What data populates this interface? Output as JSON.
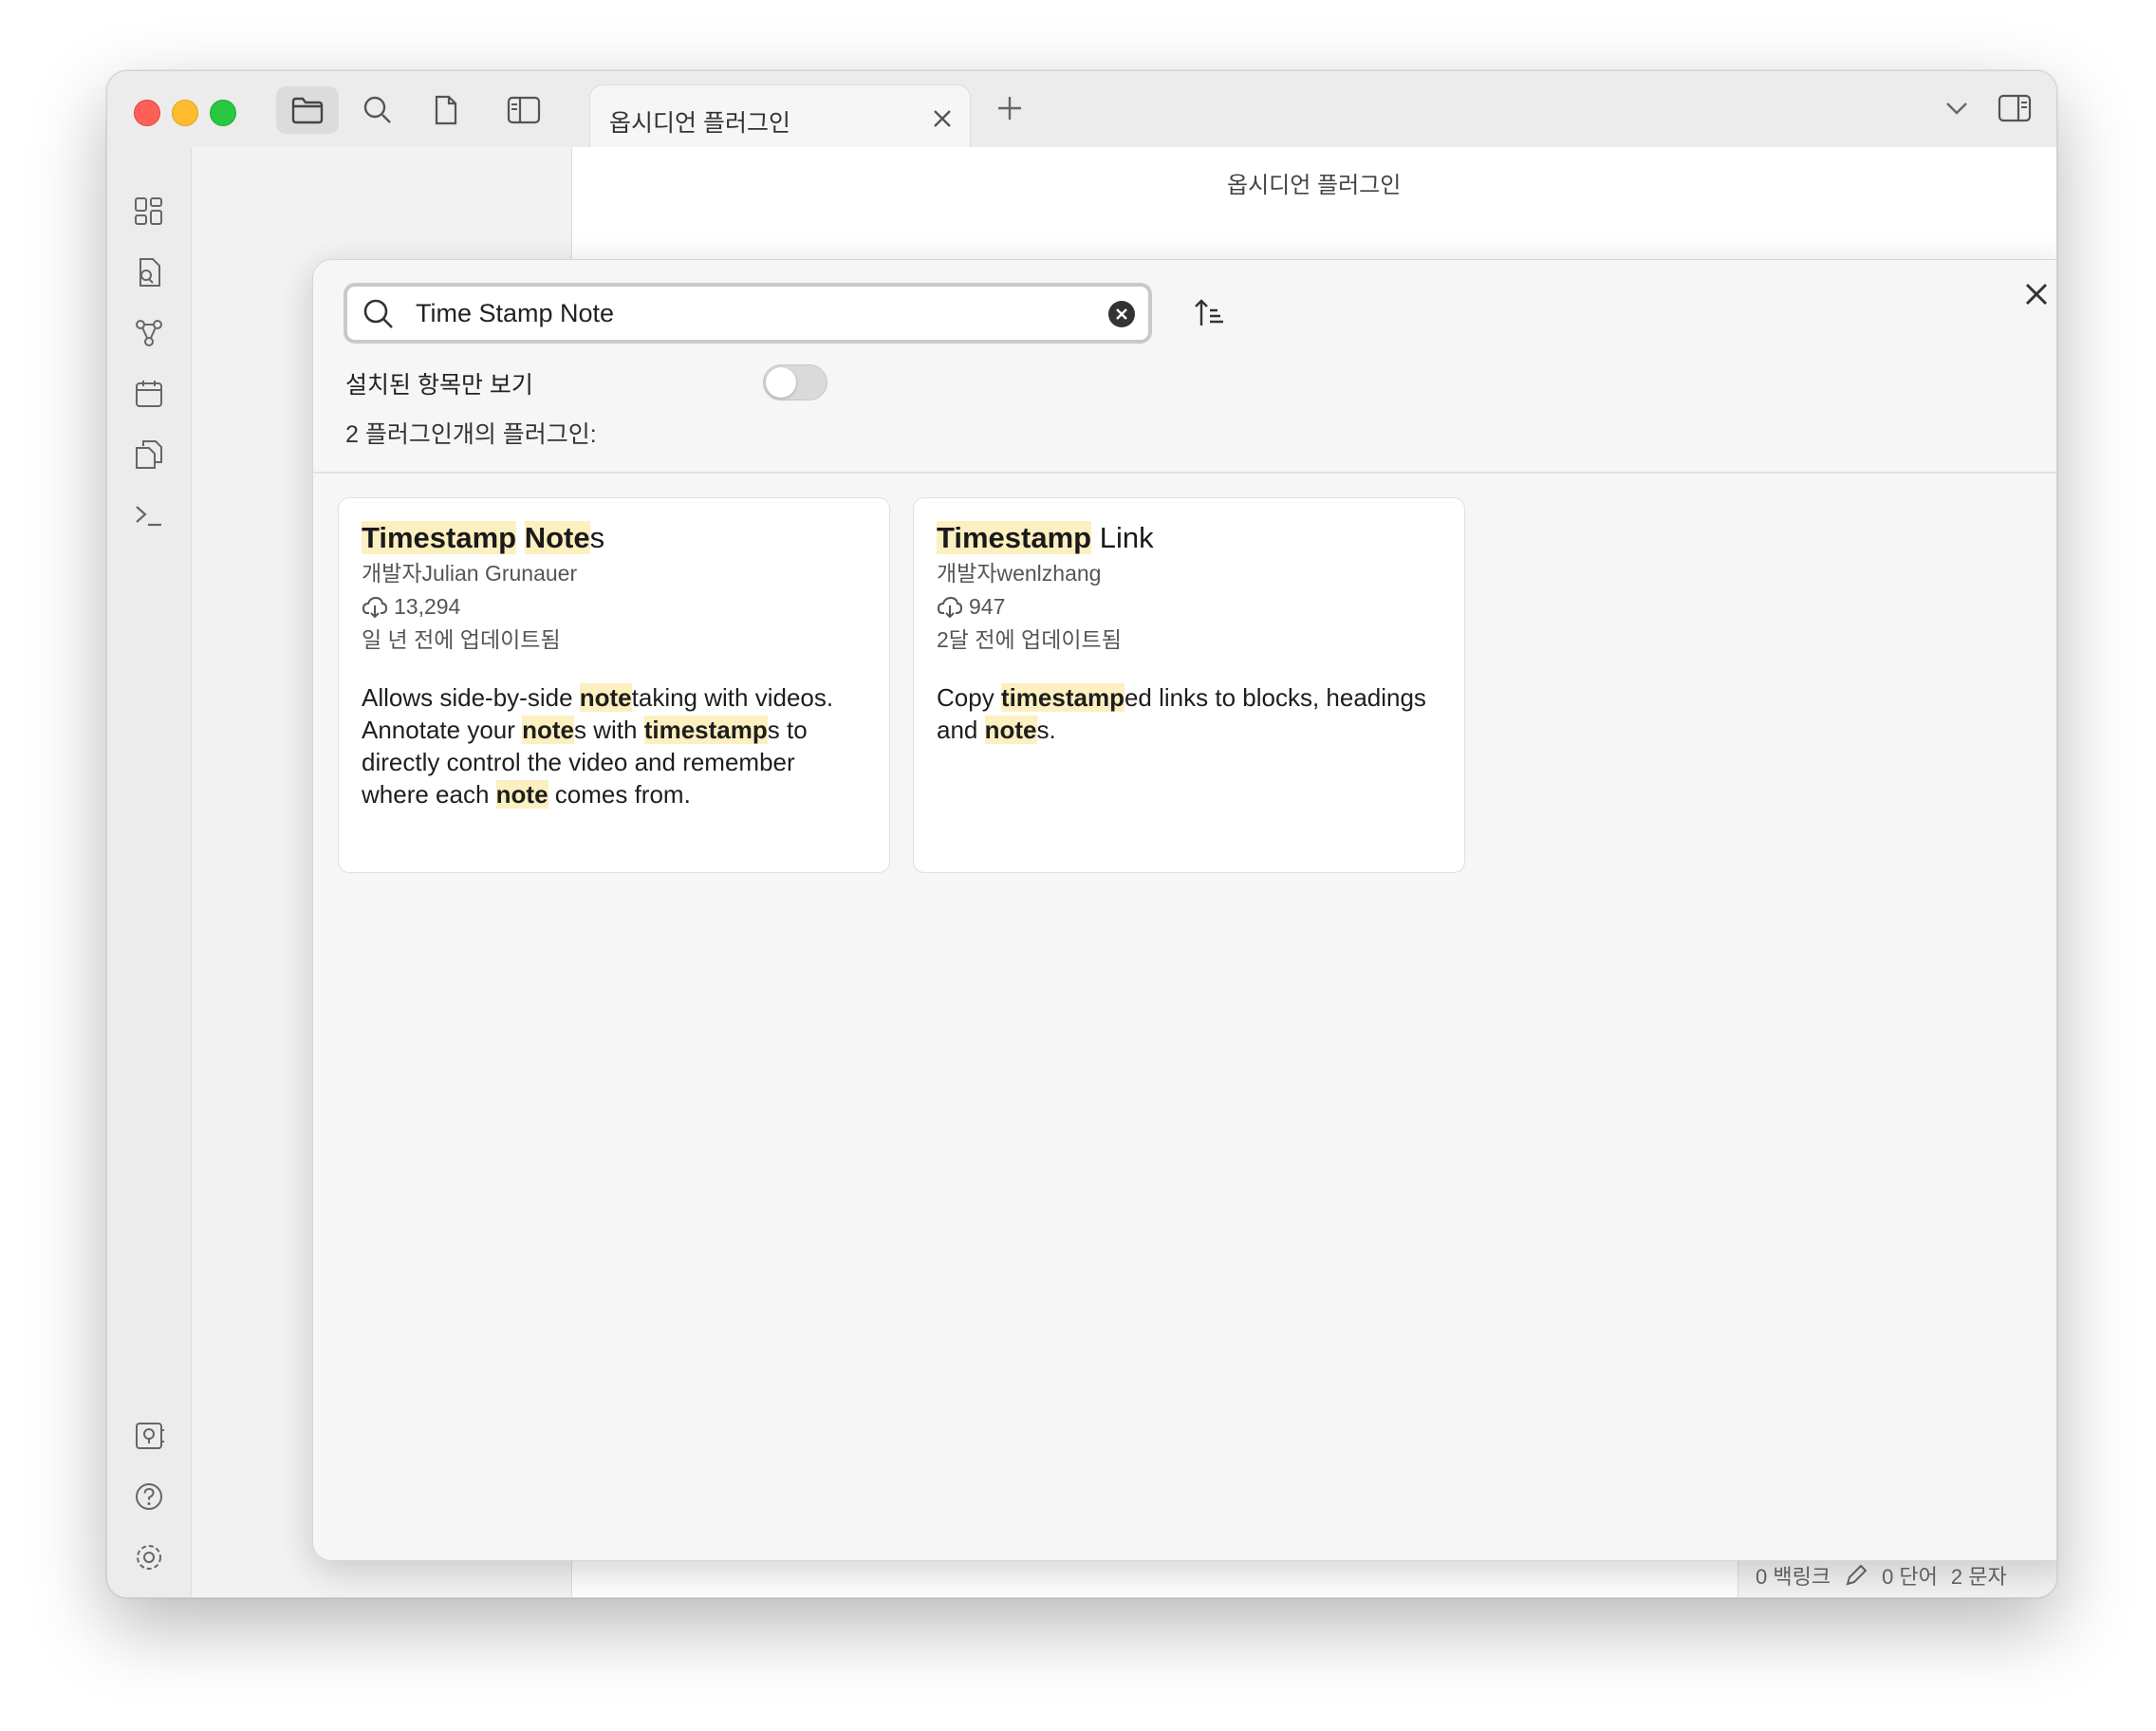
{
  "window": {
    "tab_title": "옵시디언 플러그인",
    "main_title": "옵시디언 플러그인"
  },
  "status_bar": {
    "backlinks": "0 백링크",
    "words": "0 단어",
    "chars": "2 문자"
  },
  "modal": {
    "search": {
      "value": "Time Stamp Note",
      "placeholder": ""
    },
    "installed_only_label": "설치된 항목만 보기",
    "installed_only": false,
    "result_count": "2 플러그인개의 플러그인:",
    "plugins": [
      {
        "title_pre": "",
        "title_hl1": "Timestamp",
        "title_mid": " ",
        "title_hl2": "Note",
        "title_post": "s",
        "author": "개발자Julian Grunauer",
        "downloads": "13,294",
        "updated": "일 년 전에 업데이트됨",
        "desc": [
          "Allows side-by-side ",
          "note",
          "taking with videos. Annotate your ",
          "note",
          "s with ",
          "timestamp",
          "s to directly control the video and remember where each ",
          "note",
          " comes from."
        ]
      },
      {
        "title_hl1": "Timestamp",
        "title_rest": " Link",
        "author": "개발자wenlzhang",
        "downloads": "947",
        "updated": "2달 전에 업데이트됨",
        "desc": [
          "Copy ",
          "timestamp",
          "ed links to blocks, headings and ",
          "note",
          "s."
        ]
      }
    ]
  },
  "icons": {
    "ribbon": [
      "dashboard-icon",
      "file-search-icon",
      "graph-icon",
      "calendar-icon",
      "copy-icon",
      "terminal-icon"
    ],
    "ribbon_bottom": [
      "vault-icon",
      "help-icon",
      "settings-icon"
    ]
  },
  "colors": {
    "highlight": "#fdf0c0",
    "traffic_red": "#fe5f57",
    "traffic_yellow": "#febc2e",
    "traffic_green": "#28c840"
  }
}
